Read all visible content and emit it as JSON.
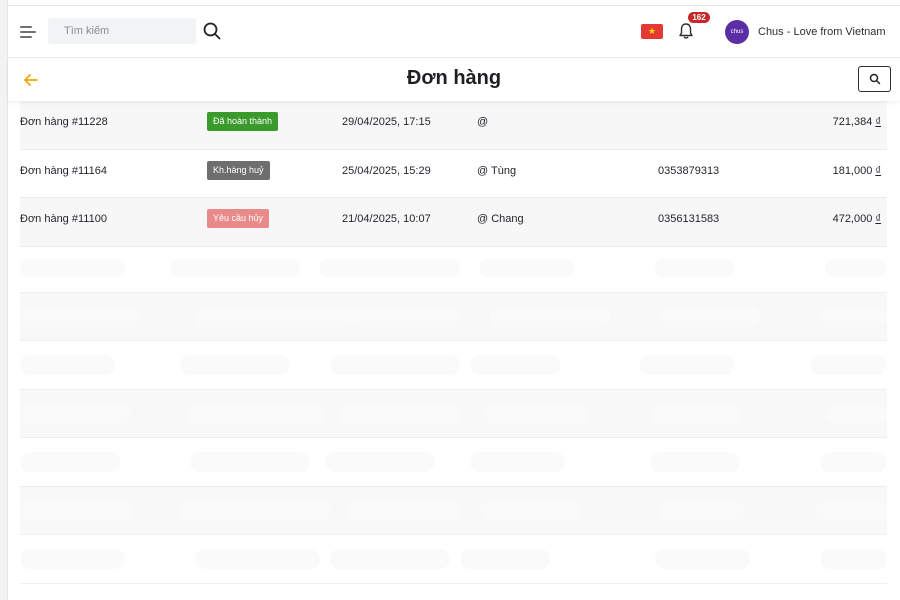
{
  "topbar": {
    "search_placeholder": "Tìm kiếm",
    "notification_count": "162",
    "avatar_text": "chus",
    "store_name": "Chus - Love from Vietnam"
  },
  "page": {
    "title": "Đơn hàng"
  },
  "orders": [
    {
      "code": "Đơn hàng #11228",
      "status": "Đã hoàn thành",
      "status_color": "#3a9a2c",
      "datetime": "29/04/2025, 17:15",
      "customer": "@",
      "phone": "",
      "total": "721,384",
      "currency": "₫"
    },
    {
      "code": "Đơn hàng #11164",
      "status": "Kh.hàng huỷ",
      "status_color": "#6e6e6e",
      "datetime": "25/04/2025, 15:29",
      "customer": "@ Tùng",
      "phone": "0353879313",
      "total": "181,000",
      "currency": "₫"
    },
    {
      "code": "Đơn hàng #11100",
      "status": "Yêu cầu hủy",
      "status_color": "#e98a8a",
      "datetime": "21/04/2025, 10:07",
      "customer": "@ Chang",
      "phone": "0356131583",
      "total": "472,000",
      "currency": "₫"
    }
  ],
  "colors": {
    "accent_back_arrow": "#f2a50c",
    "notification_badge": "#c62828",
    "avatar_bg": "#5b2ea6"
  }
}
